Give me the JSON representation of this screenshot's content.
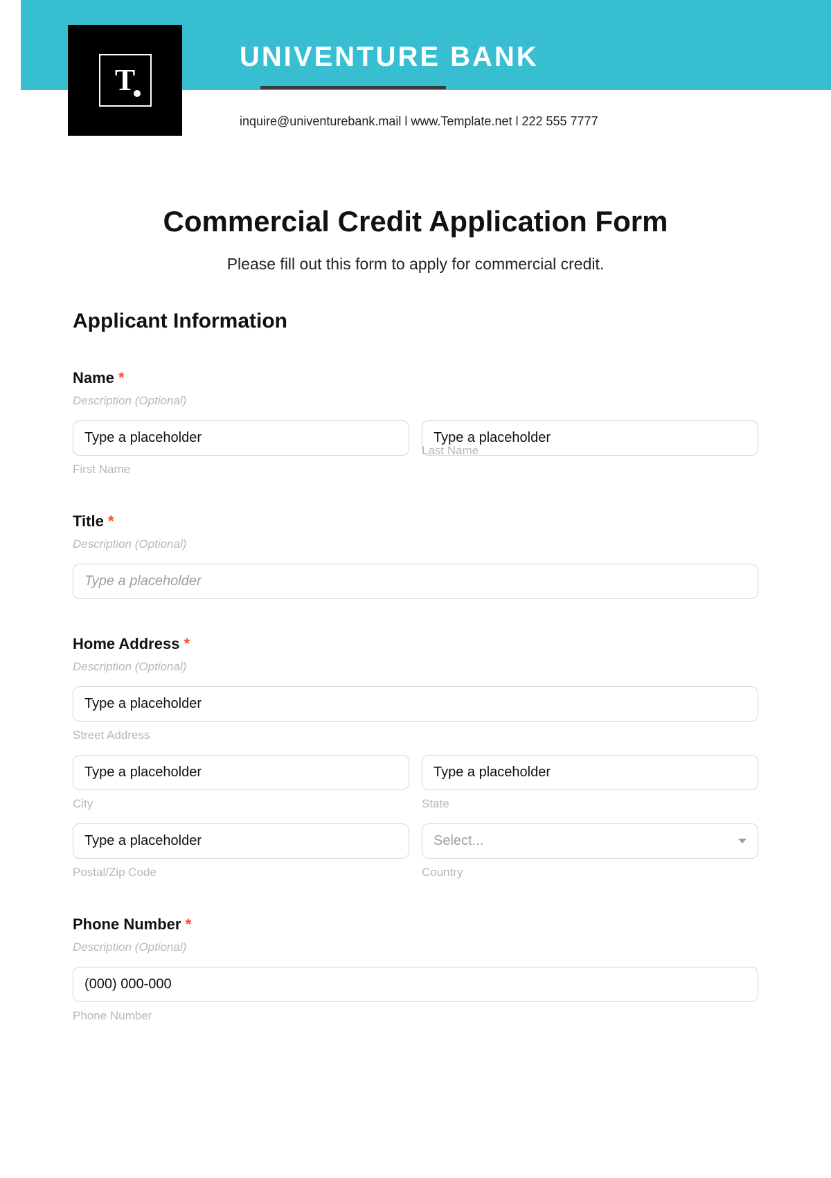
{
  "header": {
    "bank_name": "UNIVENTURE BANK",
    "logo_text": "T",
    "contact_line": "inquire@univenturebank.mail  l  www.Template.net  l  222 555 7777"
  },
  "form": {
    "title": "Commercial Credit Application Form",
    "subtitle": "Please fill out this form to apply for commercial credit.",
    "section1_heading": "Applicant Information",
    "description_optional": "Description (Optional)",
    "placeholder_text": "Type a placeholder",
    "select_placeholder": "Select...",
    "name": {
      "label": "Name",
      "first_sub": "First Name",
      "last_sub": "Last Name"
    },
    "title_field": {
      "label": "Title"
    },
    "address": {
      "label": "Home Address",
      "street_sub": "Street Address",
      "city_sub": "City",
      "state_sub": "State",
      "postal_sub": "Postal/Zip Code",
      "country_sub": "Country"
    },
    "phone": {
      "label": "Phone Number",
      "placeholder": "(000) 000-000",
      "sub": "Phone Number"
    }
  }
}
